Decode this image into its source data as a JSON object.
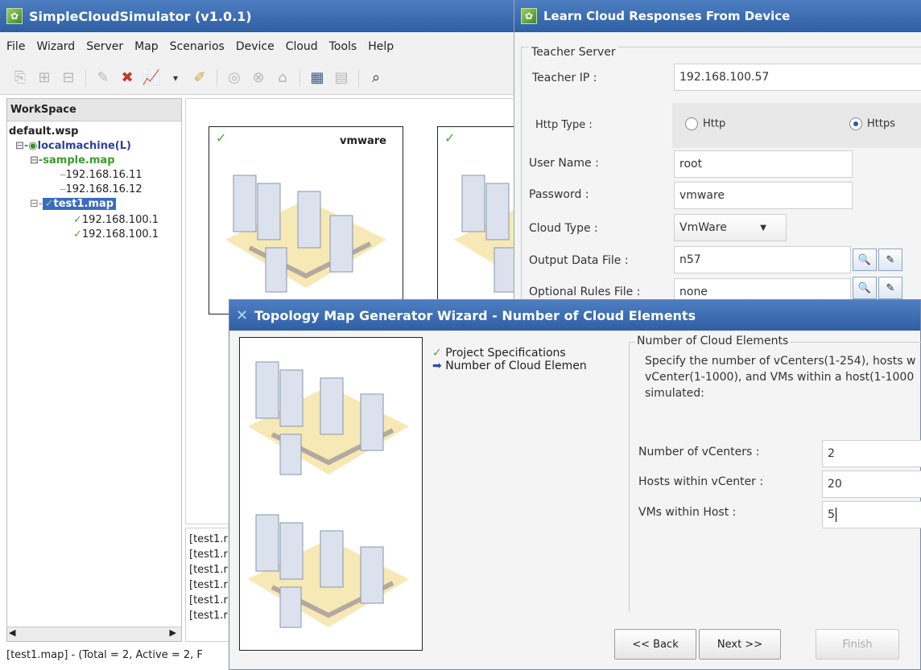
{
  "main_window": {
    "title": "SimpleCloudSimulator (v1.0.1)",
    "menu": [
      "File",
      "Wizard",
      "Server",
      "Map",
      "Scenarios",
      "Device",
      "Cloud",
      "Tools",
      "Help"
    ],
    "workspace": {
      "header": "WorkSpace",
      "root": "default.wsp",
      "machine": "localmachine(L)",
      "map1": "sample.map",
      "map1_ips": [
        "192.168.16.11",
        "192.168.16.12"
      ],
      "map2": "test1.map",
      "map2_ips": [
        "192.168.100.1",
        "192.168.100.1"
      ]
    },
    "card_brand": "vmware",
    "log_lines": [
      "[test1.r",
      "[test1.r",
      "[test1.r",
      "[test1.r",
      "[test1.r",
      "[test1.r"
    ],
    "status": "[test1.map] - (Total = 2, Active = 2, F"
  },
  "learn_dialog": {
    "title": "Learn Cloud Responses From Device",
    "group": "Teacher Server",
    "teacher_ip_label": "Teacher IP :",
    "teacher_ip": "192.168.100.57",
    "http_type_label": "Http Type :",
    "http_option": "Http",
    "https_option": "Https",
    "selected": "Https",
    "username_label": "User Name :",
    "username": "root",
    "password_label": "Password :",
    "password": "vmware",
    "cloud_type_label": "Cloud Type :",
    "cloud_type": "VmWare",
    "output_label": "Output Data File :",
    "output_value": "n57",
    "rules_label": "Optional Rules File :",
    "rules_value": "none"
  },
  "wizard": {
    "title": "Topology Map Generator Wizard - Number of Cloud Elements",
    "steps": [
      "Project Specifications",
      "Number of Cloud Elemen"
    ],
    "group": "Number of Cloud Elements",
    "description": "Specify the number of vCenters(1-254), hosts w vCenter(1-1000), and VMs within a host(1-1000 simulated:",
    "vcenters_label": "Number of vCenters :",
    "vcenters": "2",
    "hosts_label": "Hosts within vCenter :",
    "hosts": "20",
    "vms_label": "VMs within Host :",
    "vms": "5",
    "back": "<< Back",
    "next": "Next >>",
    "finish": "Finish"
  }
}
